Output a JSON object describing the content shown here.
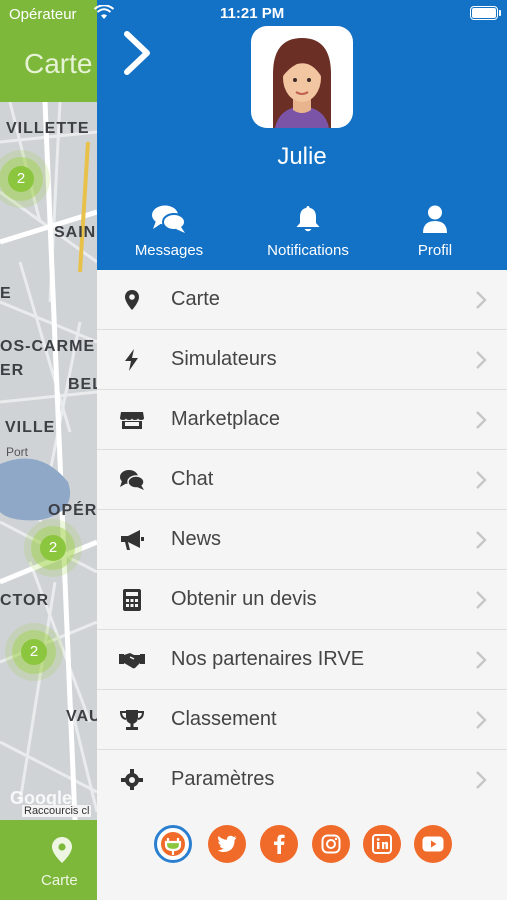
{
  "status_bar": {
    "carrier": "Opérateur",
    "time": "11:21 PM"
  },
  "background": {
    "title": "Carte",
    "map_labels": [
      "VILLETTE",
      "SAIN",
      "E",
      "OS-CARME",
      "ER",
      "BEL",
      "VILLE",
      "Port",
      "OPÉR",
      "CTOR",
      "VAU"
    ],
    "clusters": [
      "2",
      "2",
      "2"
    ],
    "google": "Google",
    "shortcuts": "Raccourcis cl",
    "tab_label": "Carte"
  },
  "drawer": {
    "user_name": "Julie",
    "header_buttons": [
      {
        "label": "Messages",
        "icon": "chat-icon"
      },
      {
        "label": "Notifications",
        "icon": "bell-icon"
      },
      {
        "label": "Profil",
        "icon": "user-icon"
      }
    ],
    "menu": [
      {
        "label": "Carte",
        "icon": "map-pin-icon"
      },
      {
        "label": "Simulateurs",
        "icon": "lightning-icon"
      },
      {
        "label": "Marketplace",
        "icon": "store-icon"
      },
      {
        "label": "Chat",
        "icon": "chat-icon"
      },
      {
        "label": "News",
        "icon": "megaphone-icon"
      },
      {
        "label": "Obtenir un devis",
        "icon": "calculator-icon"
      },
      {
        "label": "Nos partenaires IRVE",
        "icon": "handshake-icon"
      },
      {
        "label": "Classement",
        "icon": "trophy-icon"
      },
      {
        "label": "Paramètres",
        "icon": "gear-icon"
      }
    ],
    "social": [
      "app-logo-icon",
      "twitter-icon",
      "facebook-icon",
      "instagram-icon",
      "linkedin-icon",
      "youtube-icon"
    ]
  },
  "colors": {
    "drawer_header": "#1372c6",
    "app_green": "#7db83a",
    "social_orange": "#f06a2a",
    "menu_text": "#444444"
  }
}
